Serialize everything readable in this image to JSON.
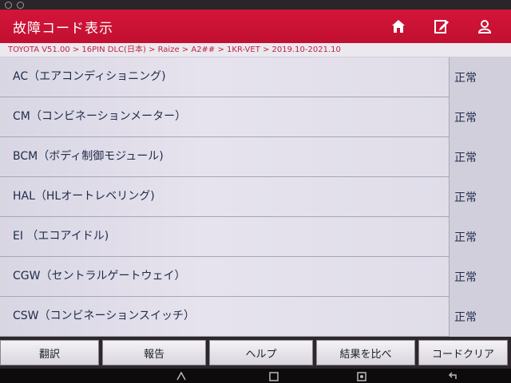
{
  "window": {
    "title": "故障コード表示"
  },
  "breadcrumb": "TOYOTA V51.00 > 16PIN DLC(日本) > Raize > A2## > 1KR-VET > 2019.10-2021.10",
  "header_icons": [
    "home-icon",
    "edit-report-icon",
    "user-icon"
  ],
  "systems": [
    {
      "name": "AC（エアコンディショニング)",
      "status": "正常"
    },
    {
      "name": "CM（コンビネーションメーター）",
      "status": "正常"
    },
    {
      "name": "BCM（ボディ制御モジュール)",
      "status": "正常"
    },
    {
      "name": "HAL（HLオートレベリング)",
      "status": "正常"
    },
    {
      "name": "EI （エコアイドル)",
      "status": "正常"
    },
    {
      "name": "CGW（セントラルゲートウェイ）",
      "status": "正常"
    },
    {
      "name": "CSW（コンビネーションスイッチ）",
      "status": "正常"
    }
  ],
  "toolbar": {
    "translate": "翻訳",
    "report": "報告",
    "help": "ヘルプ",
    "compare": "結果を比べ",
    "clear_codes": "コードクリア"
  },
  "colors": {
    "accent": "#c1102f",
    "breadcrumb_text": "#c2223e",
    "row_text": "#1f2b4a"
  },
  "nav_icons": [
    "back-triangle-icon",
    "home-square-icon",
    "screenshot-icon",
    "return-arrow-icon"
  ]
}
